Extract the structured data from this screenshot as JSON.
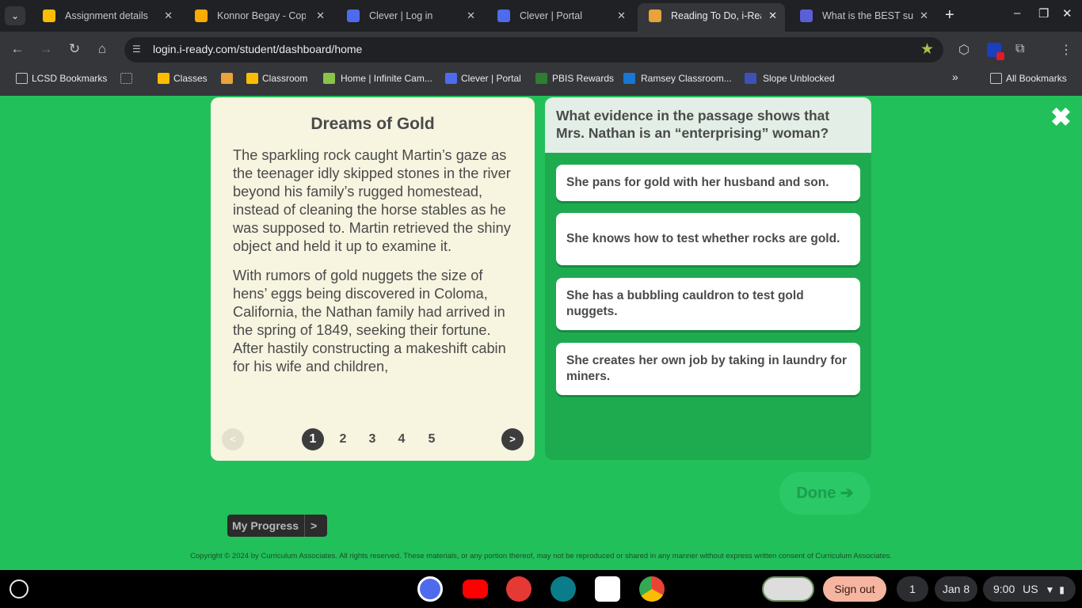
{
  "browser": {
    "tabs": [
      {
        "title": "Assignment details",
        "color": "#fbbc04"
      },
      {
        "title": "Konnor Begay - Copy of",
        "color": "#f9ab00"
      },
      {
        "title": "Clever | Log in",
        "color": "#4f6bed"
      },
      {
        "title": "Clever | Portal",
        "color": "#4f6bed"
      },
      {
        "title": "Reading To Do, i-Ready",
        "color": "#e8a33a"
      },
      {
        "title": "What is the BEST sum",
        "color": "#5a5fd8"
      }
    ],
    "url": "login.i-ready.com/student/dashboard/home",
    "bookmarks": [
      {
        "label": "LCSD Bookmarks"
      },
      {
        "label": "Classes"
      },
      {
        "label": "Classroom"
      },
      {
        "label": "Home | Infinite Cam..."
      },
      {
        "label": "Clever | Portal"
      },
      {
        "label": "PBIS Rewards"
      },
      {
        "label": "Ramsey Classroom..."
      },
      {
        "label": "Slope Unblocked"
      }
    ],
    "all_bookmarks": "All Bookmarks"
  },
  "passage": {
    "title": "Dreams of Gold",
    "paragraphs": [
      "The sparkling rock caught Martin’s gaze as the teenager idly skipped stones in the river beyond his family’s rugged homestead, instead of cleaning the horse stables as he was supposed to. Martin retrieved the shiny object and held it up to examine it.",
      "With rumors of gold nuggets the size of hens’ eggs being discovered in Coloma, California, the Nathan family had arrived in the spring of 1849, seeking their fortune. After hastily constructing a makeshift cabin for his wife and children,"
    ],
    "pages": [
      "1",
      "2",
      "3",
      "4",
      "5"
    ],
    "current_page": "1",
    "prev": "<",
    "next": ">"
  },
  "question": {
    "text": "What evidence in the passage shows that Mrs. Nathan is an “enterprising” woman?",
    "options": [
      "She pans for gold with her husband and son.",
      "She knows how to test whether rocks are gold.",
      "She has a bubbling cauldron to test gold nuggets.",
      "She creates her own job by taking in laundry for miners."
    ]
  },
  "done_label": "Done ➔",
  "close_glyph": "✖",
  "my_progress": {
    "label": "My Progress",
    "arrow": ">"
  },
  "copyright": "Copyright © 2024 by Curriculum Associates. All rights reserved. These materials, or any portion thereof, may not be reproduced or shared in any manner without express written consent of Curriculum Associates.",
  "shelf": {
    "sign_out": "Sign out",
    "notification_count": "1",
    "date": "Jan 8",
    "time": "9:00",
    "locale": "US"
  }
}
